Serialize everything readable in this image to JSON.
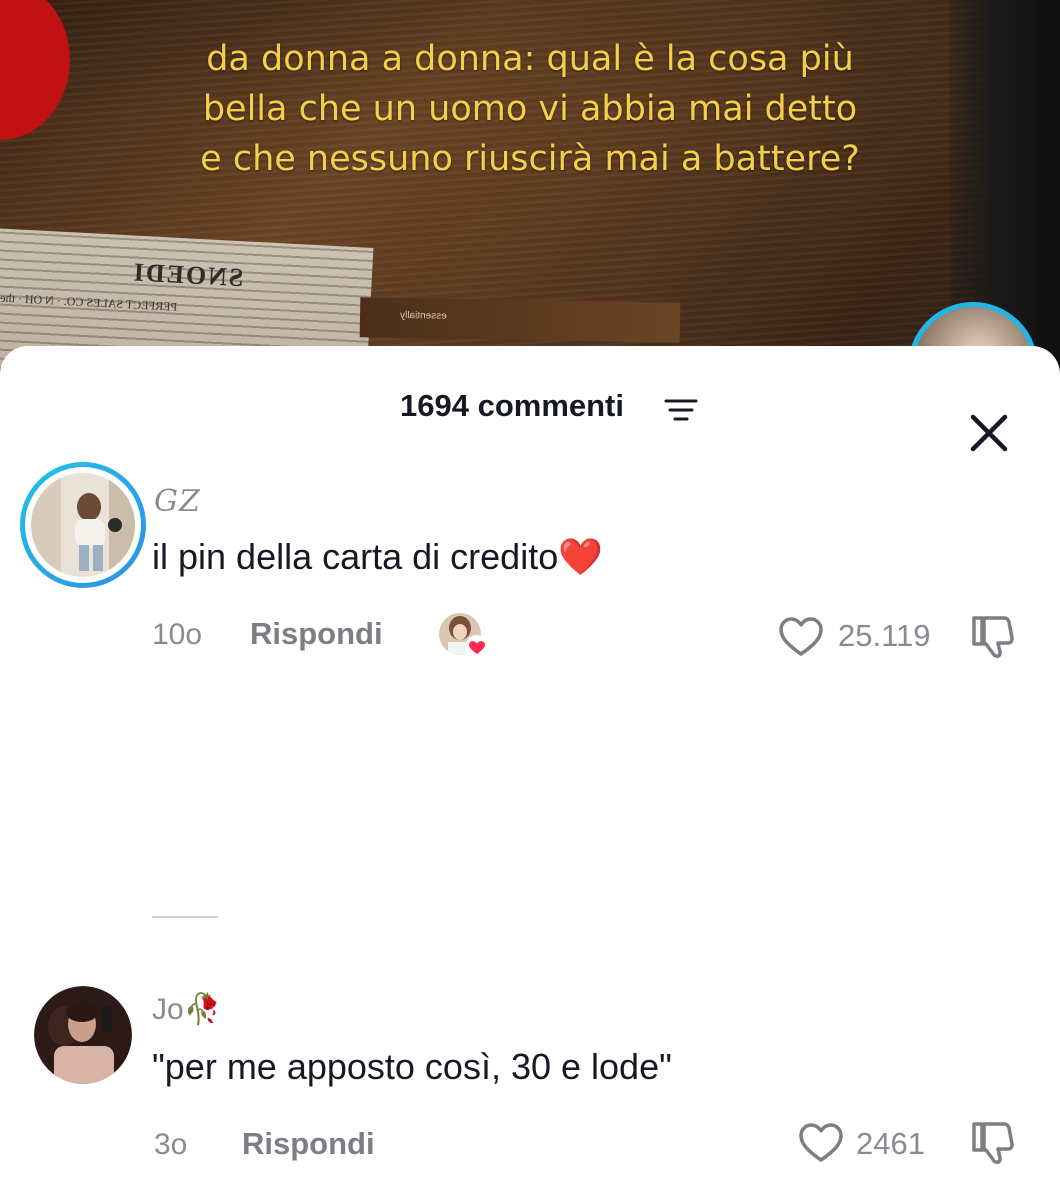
{
  "video": {
    "caption": "da donna a donna: qual è la cosa più bella che un uomo vi abbia mai detto e che nessuno riuscirà mai a battere?",
    "newspaper_headline": "SNOEDI",
    "newspaper_small": "PERFECT SALES CO. · N OH · the"
  },
  "sheet": {
    "comment_count_label": "1694 commenti",
    "filter_icon": "filter-lines-icon",
    "close_icon": "close-x-icon"
  },
  "comments": [
    {
      "username": "GZ",
      "text": "il pin della carta di credito❤️",
      "time": "10o",
      "reply_label": "Rispondi",
      "likes": "25.119",
      "creator_liked": true
    },
    {
      "username": "Jo🥀",
      "text": "\"per me apposto così, 30 e lode\"",
      "time": "3o",
      "reply_label": "Rispondi",
      "likes": "2461"
    }
  ],
  "colors": {
    "caption": "#f4cf4a",
    "ring": "#22b5e6",
    "text_primary": "#161823",
    "text_secondary": "#8a8b91",
    "heart_badge": "#fe2c55"
  }
}
